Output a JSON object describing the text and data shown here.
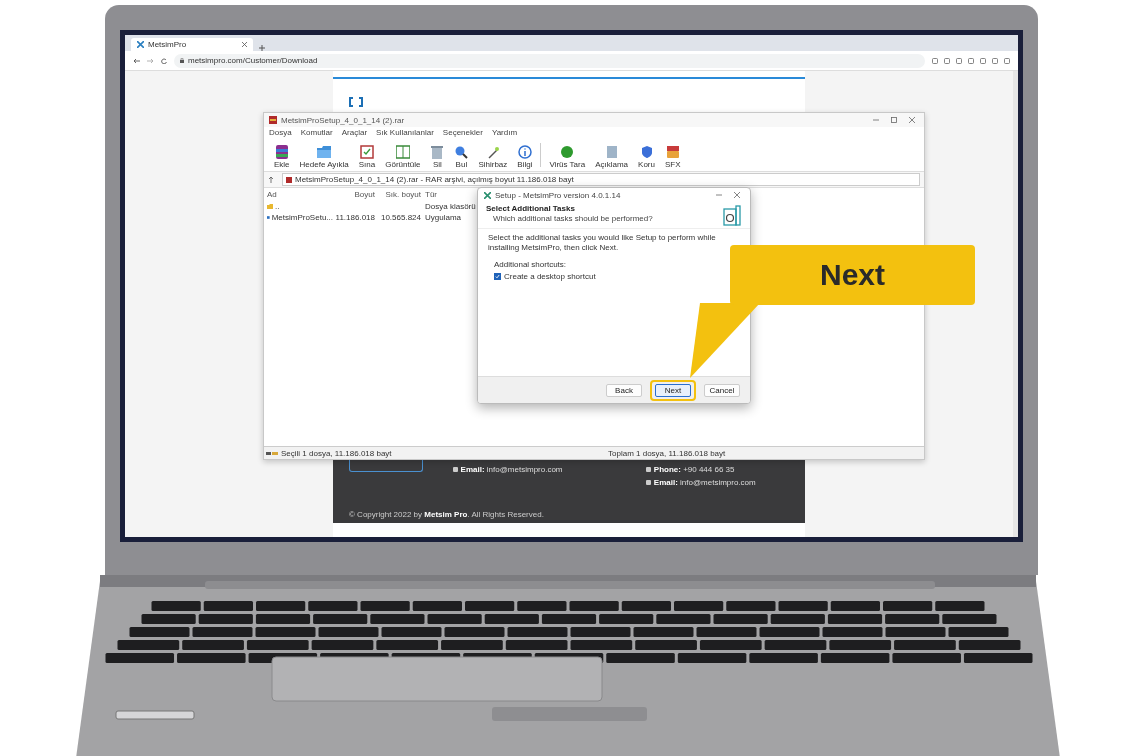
{
  "browser": {
    "tab_title": "MetsimPro",
    "url": "metsimpro.com/Customer/Download"
  },
  "website": {
    "footer_left": [
      "**Email:** info@metsimpro.com"
    ],
    "footer_right": [
      "**Phone:** +90 444 66 35",
      "**Email:** info@metsimpro.com"
    ],
    "copyright": "© Copyright 2022 by **Metsim Pro**. All Rights Reserved."
  },
  "archive_window": {
    "title": "MetsimProSetup_4_0_1_14 (2).rar",
    "menu": [
      "Dosya",
      "Komutlar",
      "Araçlar",
      "Sık Kullanılanlar",
      "Seçenekler",
      "Yardım"
    ],
    "toolbar": [
      {
        "label": "Ekle",
        "kind": "add"
      },
      {
        "label": "Hedefe Ayıkla",
        "kind": "folder"
      },
      {
        "label": "Sına",
        "kind": "test"
      },
      {
        "label": "Görüntüle",
        "kind": "view"
      },
      {
        "label": "Sil",
        "kind": "delete"
      },
      {
        "label": "Bul",
        "kind": "find"
      },
      {
        "label": "Sihirbaz",
        "kind": "wizard"
      },
      {
        "label": "Bilgi",
        "kind": "info"
      },
      {
        "label": "Virüs Tara",
        "kind": "virus"
      },
      {
        "label": "Açıklama",
        "kind": "comment"
      },
      {
        "label": "Koru",
        "kind": "protect"
      },
      {
        "label": "SFX",
        "kind": "sfx"
      }
    ],
    "path": "MetsimProSetup_4_0_1_14 (2).rar - RAR arşivi, açılmış boyut 11.186.018 bayt",
    "columns": [
      "Ad",
      "Boyut",
      "Sık. boyut",
      "Tür"
    ],
    "rows": [
      {
        "kind": "folder",
        "cells": [
          "..",
          "",
          "",
          "Dosya klasörü"
        ]
      },
      {
        "kind": "file",
        "cells": [
          "MetsimProSetu...",
          "11.186.018",
          "10.565.824",
          "Uygulama"
        ]
      }
    ],
    "status_left": "Seçili 1 dosya, 11.186.018 bayt",
    "status_right": "Toplam 1 dosya, 11.186.018 bayt"
  },
  "setup_dialog": {
    "title": "Setup - MetsimPro version 4.0.1.14",
    "heading": "Select Additional Tasks",
    "subheading": "Which additional tasks should be performed?",
    "description": "Select the additional tasks you would like Setup to perform while installing MetsimPro, then click Next.",
    "group_label": "Additional shortcuts:",
    "options": [
      {
        "label": "Create a desktop shortcut",
        "checked": true
      }
    ],
    "buttons": [
      {
        "label": "Back",
        "kind": "back",
        "highlighted": false
      },
      {
        "label": "Next",
        "kind": "next",
        "highlighted": true
      },
      {
        "label": "Cancel",
        "kind": "cancel",
        "highlighted": false
      }
    ]
  },
  "callout": {
    "text": "Next"
  }
}
